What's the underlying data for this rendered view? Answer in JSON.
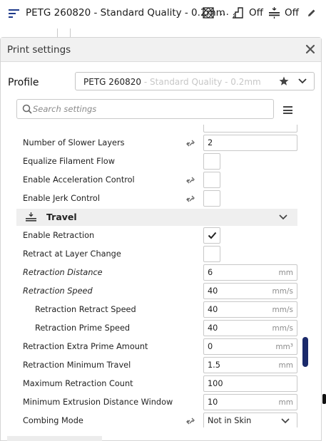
{
  "topbar": {
    "title": "PETG 260820 - Standard Quality - 0.2mm",
    "ellipsis": "...",
    "support_value": "Off",
    "adhesion_value": "Off",
    "accent_color": "#1e3a8a"
  },
  "panel": {
    "title": "Print settings",
    "profile_label": "Profile",
    "profile_name": "PETG 260820",
    "profile_suffix": " - Standard Quality - 0.2mm",
    "search_placeholder": "Search settings"
  },
  "settings": {
    "rows": [
      {
        "label": "Number of Slower Layers",
        "value": "2",
        "unit": ""
      },
      {
        "label": "Equalize Filament Flow"
      },
      {
        "label": "Enable Acceleration Control"
      },
      {
        "label": "Enable Jerk Control"
      },
      {
        "label": "Enable Retraction",
        "checked": true
      },
      {
        "label": "Retract at Layer Change",
        "checked": false
      },
      {
        "label": "Retraction Distance",
        "value": "6",
        "unit": "mm"
      },
      {
        "label": "Retraction Speed",
        "value": "40",
        "unit": "mm/s"
      },
      {
        "label": "Retraction Retract Speed",
        "value": "40",
        "unit": "mm/s"
      },
      {
        "label": "Retraction Prime Speed",
        "value": "40",
        "unit": "mm/s"
      },
      {
        "label": "Retraction Extra Prime Amount",
        "value": "0",
        "unit": "mm³"
      },
      {
        "label": "Retraction Minimum Travel",
        "value": "1.5",
        "unit": "mm"
      },
      {
        "label": "Maximum Retraction Count",
        "value": "100",
        "unit": ""
      },
      {
        "label": "Minimum Extrusion Distance Window",
        "value": "10",
        "unit": "mm"
      },
      {
        "label": "Combing Mode",
        "value": "Not in Skin"
      }
    ],
    "travel_category": "Travel"
  }
}
